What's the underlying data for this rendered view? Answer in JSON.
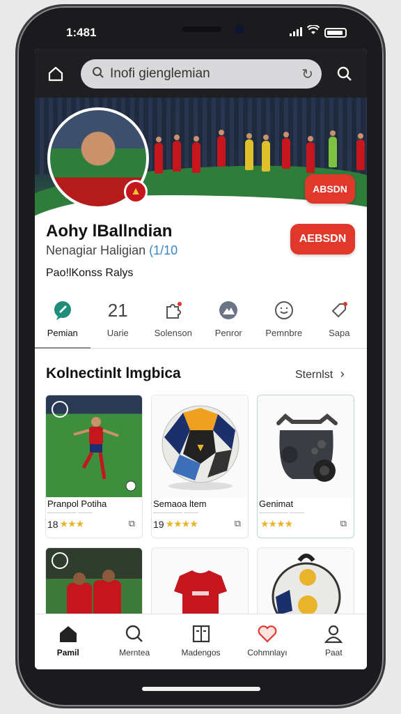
{
  "status": {
    "time": "1:481"
  },
  "search": {
    "text": "Inofi gienglemian"
  },
  "profile": {
    "name": "Aohy lBallndian",
    "subtitle": "Nenagiar Haligian",
    "subtitle_tag": "(1/10",
    "description": "Pao!lKonss Ralys",
    "button_top": "ABSDN",
    "button_main": "AEBSDN"
  },
  "tabs": [
    {
      "label": "Pemian",
      "icon": "chat-bubble-icon"
    },
    {
      "label": "Uarie",
      "icon": "number-21-icon",
      "value": "21"
    },
    {
      "label": "Solenson",
      "icon": "puzzle-icon"
    },
    {
      "label": "Penror",
      "icon": "mountain-icon"
    },
    {
      "label": "Pemnbre",
      "icon": "robot-face-icon"
    },
    {
      "label": "Sapa",
      "icon": "tag-icon"
    }
  ],
  "section": {
    "title": "Kolnectinlt lmgbica",
    "see_all": "Sternlst"
  },
  "cards": [
    {
      "title": "Pranpol Potiha",
      "meta": "—————— ———",
      "rating": "18",
      "stars": "★★★"
    },
    {
      "title": "Semaoa ltem",
      "meta": "—————— ———",
      "rating": "19",
      "stars": "★★★★"
    },
    {
      "title": "Genimat",
      "meta": "—————— ———",
      "rating": "",
      "stars": "★★★★"
    }
  ],
  "nav": [
    {
      "label": "Pamil",
      "icon": "home-icon"
    },
    {
      "label": "Merntea",
      "icon": "search-icon"
    },
    {
      "label": "Madengos",
      "icon": "book-icon"
    },
    {
      "label": "Cohmnlayı",
      "icon": "heart-icon"
    },
    {
      "label": "Paat",
      "icon": "person-icon"
    }
  ],
  "colors": {
    "accent": "#e2372b",
    "header": "#1f1f22",
    "star": "#e9b32b",
    "pitch": "#2f7d3a"
  }
}
